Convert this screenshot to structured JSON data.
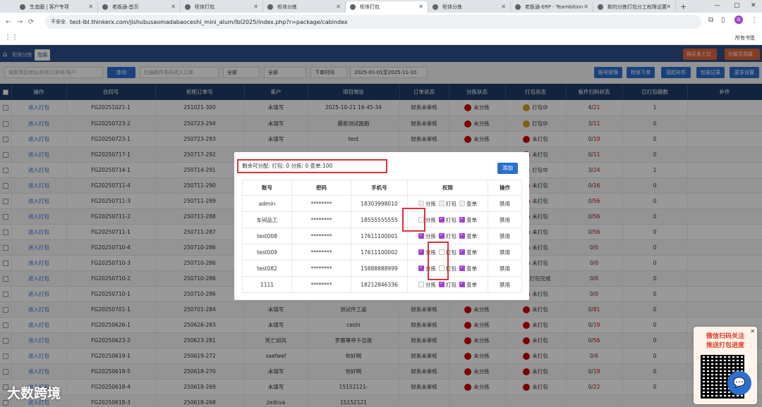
{
  "browser": {
    "tabs": [
      {
        "label": "生态圈 | 客户专项"
      },
      {
        "label": "老板通-首页"
      },
      {
        "label": "柜体打包"
      },
      {
        "label": "柜体分拣"
      },
      {
        "label": "柜体打包",
        "active": true
      },
      {
        "label": "柜体分拣"
      },
      {
        "label": "老板通-ERP - Teambition"
      },
      {
        "label": "新的分拣打包分工权限设置"
      }
    ],
    "insecure_label": "不安全",
    "url": "test-lbl.thinkerx.com/jishubusaomadabaoceshi_mini_alum/lbl2025/index.php?r=package/cabindex",
    "bookmarks_all": "所有书签",
    "profile_initial": "G"
  },
  "header": {
    "tabs": [
      {
        "label": "柜体分拣"
      },
      {
        "label": "包装"
      }
    ],
    "buttons": [
      "购买多工位",
      "升级至高级版"
    ]
  },
  "filter": {
    "search_placeholder": "搜索项目地址/柜柜订单号/客户",
    "query_label": "查询",
    "scan_placeholder": "扫描板件条码进入订单",
    "select1": "全部",
    "select2": "全部",
    "time_select": "下单时间",
    "date_range": "2025-01-01至2025-11-10",
    "right_buttons": [
      "账号管理",
      "柜体下单",
      "宽起补件",
      "包装记录",
      "更多设置"
    ]
  },
  "table": {
    "headers": [
      "",
      "操作",
      "合同号",
      "柜柜订单号",
      "客户",
      "项目地址",
      "订单状态",
      "分拣状态",
      "打包状态",
      "板件扫码状态",
      "已打包箱数",
      "补件"
    ],
    "rows": [
      {
        "action": "进入打包",
        "contract": "FG20251021-1",
        "order": "251021-300",
        "customer": "未填写",
        "address": "2025-10-21 16-45-34",
        "status": "财务未审核",
        "sort": "未分拣",
        "pack": "打包中",
        "pack_color": "#d4a017",
        "scan": "4/21",
        "boxes": "1"
      },
      {
        "action": "进入打包",
        "contract": "FG20250723-2",
        "order": "250723-294",
        "customer": "未填写",
        "address": "最新测试跑跑",
        "status": "财务未审核",
        "sort": "未分拣",
        "pack": "打包中",
        "pack_color": "#d4a017",
        "scan": "3/11",
        "boxes": "0"
      },
      {
        "action": "进入打包",
        "contract": "FG20250723-1",
        "order": "250723-293",
        "customer": "未填写",
        "address": "test",
        "status": "财务未审核",
        "sort": "未分拣",
        "pack": "未打包",
        "pack_color": "#d00000",
        "scan": "0/19",
        "boxes": "0"
      },
      {
        "action": "进入打包",
        "contract": "FG20250717-1",
        "order": "250717-292",
        "customer": "",
        "address": "",
        "status": "",
        "sort": "",
        "pack": "未打包",
        "pack_color": "#d00000",
        "scan": "0/11",
        "boxes": "0"
      },
      {
        "action": "进入打包",
        "contract": "FG20250714-1",
        "order": "250714-291",
        "customer": "",
        "address": "",
        "status": "",
        "sort": "",
        "pack": "打包中",
        "pack_color": "#d4a017",
        "scan": "3/24",
        "boxes": "1"
      },
      {
        "action": "进入打包",
        "contract": "FG20250711-4",
        "order": "250711-290",
        "customer": "",
        "address": "",
        "status": "",
        "sort": "",
        "pack": "未打包",
        "pack_color": "#d00000",
        "scan": "0/16",
        "boxes": "0"
      },
      {
        "action": "进入打包",
        "contract": "FG20250711-3",
        "order": "250711-289",
        "customer": "",
        "address": "",
        "status": "",
        "sort": "",
        "pack": "未打包",
        "pack_color": "#d00000",
        "scan": "0/56",
        "boxes": "0"
      },
      {
        "action": "进入打包",
        "contract": "FG20250711-2",
        "order": "250711-288",
        "customer": "",
        "address": "",
        "status": "",
        "sort": "",
        "pack": "未打包",
        "pack_color": "#d00000",
        "scan": "0/56",
        "boxes": "0"
      },
      {
        "action": "进入打包",
        "contract": "FG20250711-1",
        "order": "250711-287",
        "customer": "",
        "address": "",
        "status": "",
        "sort": "",
        "pack": "未打包",
        "pack_color": "#d00000",
        "scan": "0/56",
        "boxes": "0"
      },
      {
        "action": "进入打包",
        "contract": "FG20250710-4",
        "order": "250710-286",
        "customer": "",
        "address": "",
        "status": "",
        "sort": "",
        "pack": "未打包",
        "pack_color": "#d00000",
        "scan": "0/0",
        "boxes": "0"
      },
      {
        "action": "进入打包",
        "contract": "FG20250710-3",
        "order": "250710-286",
        "customer": "",
        "address": "",
        "status": "",
        "sort": "",
        "pack": "未打包",
        "pack_color": "#d00000",
        "scan": "0/0",
        "boxes": "0"
      },
      {
        "action": "进入打包",
        "contract": "FG20250710-2",
        "order": "250710-286",
        "customer": "",
        "address": "",
        "status": "",
        "sort": "",
        "pack": "打包完成",
        "pack_color": "#2aa02a",
        "scan": "0/0",
        "boxes": "0"
      },
      {
        "action": "进入打包",
        "contract": "FG20250710-1",
        "order": "250710-286",
        "customer": "",
        "address": "",
        "status": "",
        "sort": "",
        "pack": "未打包",
        "pack_color": "#d00000",
        "scan": "0/0",
        "boxes": "0"
      },
      {
        "action": "进入打包",
        "contract": "FG20250701-1",
        "order": "250701-284",
        "customer": "未填写",
        "address": "测试件工姿",
        "status": "财务未审核",
        "sort": "未分拣",
        "pack": "未打包",
        "pack_color": "#d00000",
        "scan": "0/81",
        "boxes": "0"
      },
      {
        "action": "进入打包",
        "contract": "FG20250626-1",
        "order": "250626-283",
        "customer": "未填写",
        "address": "ceshi",
        "status": "财务未审核",
        "sort": "未分拣",
        "pack": "未打包",
        "pack_color": "#d00000",
        "scan": "0/19",
        "boxes": "0"
      },
      {
        "action": "进入打包",
        "contract": "FG20250623-2",
        "order": "250623-281",
        "customer": "死亡如风",
        "address": "罗蕾尊帝千百度",
        "status": "财务未审核",
        "sort": "未分拣",
        "pack": "未打包",
        "pack_color": "#d00000",
        "scan": "0/56",
        "boxes": "0"
      },
      {
        "action": "进入打包",
        "contract": "FG20250619-1",
        "order": "250619-272",
        "customer": "saefwef",
        "address": "你好啊",
        "status": "财务未审核",
        "sort": "未分拣",
        "pack": "未打包",
        "pack_color": "#d00000",
        "scan": "0/6",
        "boxes": "0"
      },
      {
        "action": "进入打包",
        "contract": "FG20250618-5",
        "order": "250618-270",
        "customer": "未填写",
        "address": "你好啊",
        "status": "财务未审核",
        "sort": "未分拣",
        "pack": "未打包",
        "pack_color": "#d00000",
        "scan": "0/19",
        "boxes": "0"
      },
      {
        "action": "进入打包",
        "contract": "FG20250618-4",
        "order": "250618-269",
        "customer": "未填写",
        "address": "15152121-",
        "status": "财务未审核",
        "sort": "未分拣",
        "pack": "未打包",
        "pack_color": "#d00000",
        "scan": "0/22",
        "boxes": "0"
      },
      {
        "action": "进入打包",
        "contract": "FG20250618-3",
        "order": "250618-268",
        "customer": "zxdcva",
        "address": "15152121",
        "status": "",
        "sort": "",
        "pack": "",
        "pack_color": "#d00000",
        "scan": "",
        "boxes": ""
      }
    ]
  },
  "modal": {
    "summary": "剩余可分配: 打包: 0   分拣: 0   查单:100",
    "add_label": "添加",
    "headers": [
      "账号",
      "密码",
      "手机号",
      "权限",
      "操作"
    ],
    "perm_labels": [
      "分拣",
      "打包",
      "查单"
    ],
    "rows": [
      {
        "account": "admin",
        "password": "********",
        "phone": "18303998010",
        "perms": [
          "dis",
          "dis",
          "dis"
        ],
        "op": "禁用"
      },
      {
        "account": "车间品工",
        "password": "********",
        "phone": "18555555555",
        "perms": [
          "off",
          "on",
          "on"
        ],
        "op": "禁用"
      },
      {
        "account": "test008",
        "password": "********",
        "phone": "17611100001",
        "perms": [
          "on",
          "on",
          "on"
        ],
        "op": "禁用"
      },
      {
        "account": "test009",
        "password": "********",
        "phone": "17611100002",
        "perms": [
          "on",
          "off",
          "on"
        ],
        "op": "禁用"
      },
      {
        "account": "test082",
        "password": "********",
        "phone": "15888888999",
        "perms": [
          "on",
          "off",
          "on"
        ],
        "op": "禁用"
      },
      {
        "account": "1111",
        "password": "********",
        "phone": "18212846336",
        "perms": [
          "off",
          "on",
          "on"
        ],
        "op": "禁用"
      }
    ]
  },
  "widget": {
    "title_line1": "微信扫码关注",
    "title_line2": "推送打包进度"
  },
  "watermark": "大数跨境",
  "colors": {
    "header": "#2c4f8a",
    "table_header": "#1f3c66",
    "accent": "#2a6fd0",
    "highlight": "#d9323b",
    "check": "#a43fd1"
  }
}
